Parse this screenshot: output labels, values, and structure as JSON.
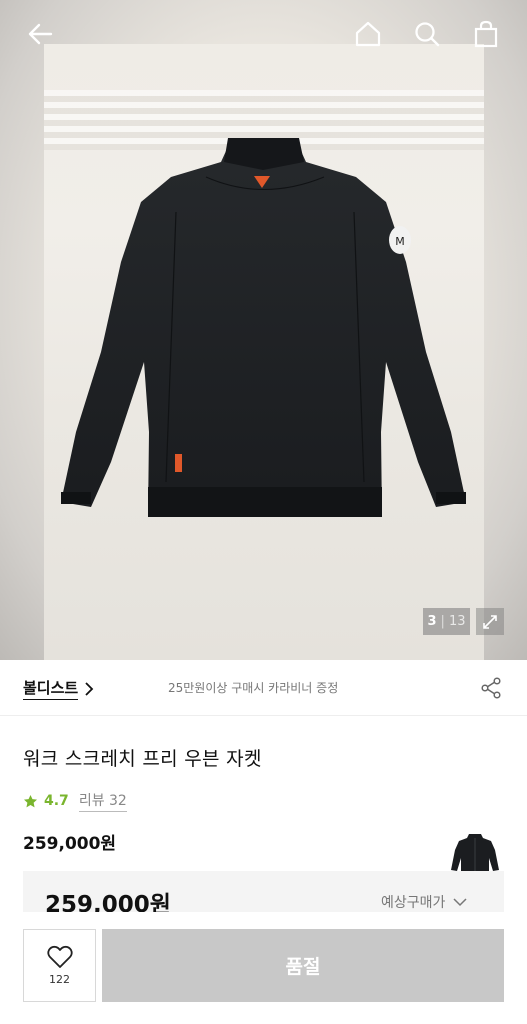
{
  "hero": {
    "image": "work-stretch-jacket-back-view",
    "counter_current": "3",
    "counter_separator": "|",
    "counter_total": "13"
  },
  "topbar": {
    "icons": [
      "back-arrow-icon",
      "home-icon",
      "search-icon",
      "shopping-bag-icon"
    ]
  },
  "brand": {
    "name": "볼디스트",
    "promo": "25만원이상 구매시 카라비너 증정"
  },
  "product": {
    "title": "워크 스크레치 프리 우븐 자켓",
    "rating": "4.7",
    "reviews_label": "리뷰 32",
    "price": "259,000원",
    "expected_price": "259,000원",
    "expected_label": "예상구매가"
  },
  "actions": {
    "like_count": "122",
    "soldout_label": "품절"
  },
  "colors": {
    "star": "#7ab52e",
    "soldout_bg": "#c8c8c8",
    "jacket": "#1e2124"
  }
}
